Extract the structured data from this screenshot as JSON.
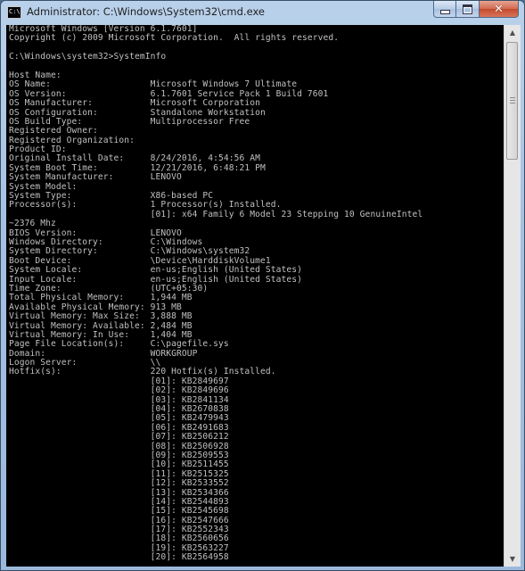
{
  "window": {
    "title": "Administrator: C:\\Windows\\System32\\cmd.exe",
    "icon": "cmd-icon",
    "icon_text": "C:\\"
  },
  "caption": {
    "minimize_icon": "minimize-icon",
    "maximize_icon": "maximize-icon",
    "close_icon": "close-icon",
    "close_glyph": "✕"
  },
  "console": {
    "text_color": "#c0c0c0",
    "background": "#000000",
    "lines": [
      "Microsoft Windows [Version 6.1.7601]",
      "Copyright (c) 2009 Microsoft Corporation.  All rights reserved.",
      "",
      "C:\\Windows\\system32>SystemInfo",
      "",
      "Host Name:",
      "OS Name:                   Microsoft Windows 7 Ultimate",
      "OS Version:                6.1.7601 Service Pack 1 Build 7601",
      "OS Manufacturer:           Microsoft Corporation",
      "OS Configuration:          Standalone Workstation",
      "OS Build Type:             Multiprocessor Free",
      "Registered Owner:",
      "Registered Organization:",
      "Product ID:",
      "Original Install Date:     8/24/2016, 4:54:56 AM",
      "System Boot Time:          12/21/2016, 6:48:21 PM",
      "System Manufacturer:       LENOVO",
      "System Model:",
      "System Type:               X86-based PC",
      "Processor(s):              1 Processor(s) Installed.",
      "                           [01]: x64 Family 6 Model 23 Stepping 10 GenuineIntel",
      "~2376 Mhz",
      "BIOS Version:              LENOVO",
      "Windows Directory:         C:\\Windows",
      "System Directory:          C:\\Windows\\system32",
      "Boot Device:               \\Device\\HarddiskVolume1",
      "System Locale:             en-us;English (United States)",
      "Input Locale:              en-us;English (United States)",
      "Time Zone:                 (UTC+05:30)",
      "Total Physical Memory:     1,944 MB",
      "Available Physical Memory: 913 MB",
      "Virtual Memory: Max Size:  3,888 MB",
      "Virtual Memory: Available: 2,484 MB",
      "Virtual Memory: In Use:    1,404 MB",
      "Page File Location(s):     C:\\pagefile.sys",
      "Domain:                    WORKGROUP",
      "Logon Server:              \\\\",
      "Hotfix(s):                 220 Hotfix(s) Installed.",
      "                           [01]: KB2849697",
      "                           [02]: KB2849696",
      "                           [03]: KB2841134",
      "                           [04]: KB2670838",
      "                           [05]: KB2479943",
      "                           [06]: KB2491683",
      "                           [07]: KB2506212",
      "                           [08]: KB2506928",
      "                           [09]: KB2509553",
      "                           [10]: KB2511455",
      "                           [11]: KB2515325",
      "                           [12]: KB2533552",
      "                           [13]: KB2534366",
      "                           [14]: KB2544893",
      "                           [15]: KB2545698",
      "                           [16]: KB2547666",
      "                           [17]: KB2552343",
      "                           [18]: KB2560656",
      "                           [19]: KB2563227",
      "                           [20]: KB2564958"
    ]
  },
  "scrollbar": {
    "up_icon": "scroll-up-arrow-icon",
    "down_icon": "scroll-down-arrow-icon",
    "up_glyph": "▲",
    "down_glyph": "▼"
  }
}
